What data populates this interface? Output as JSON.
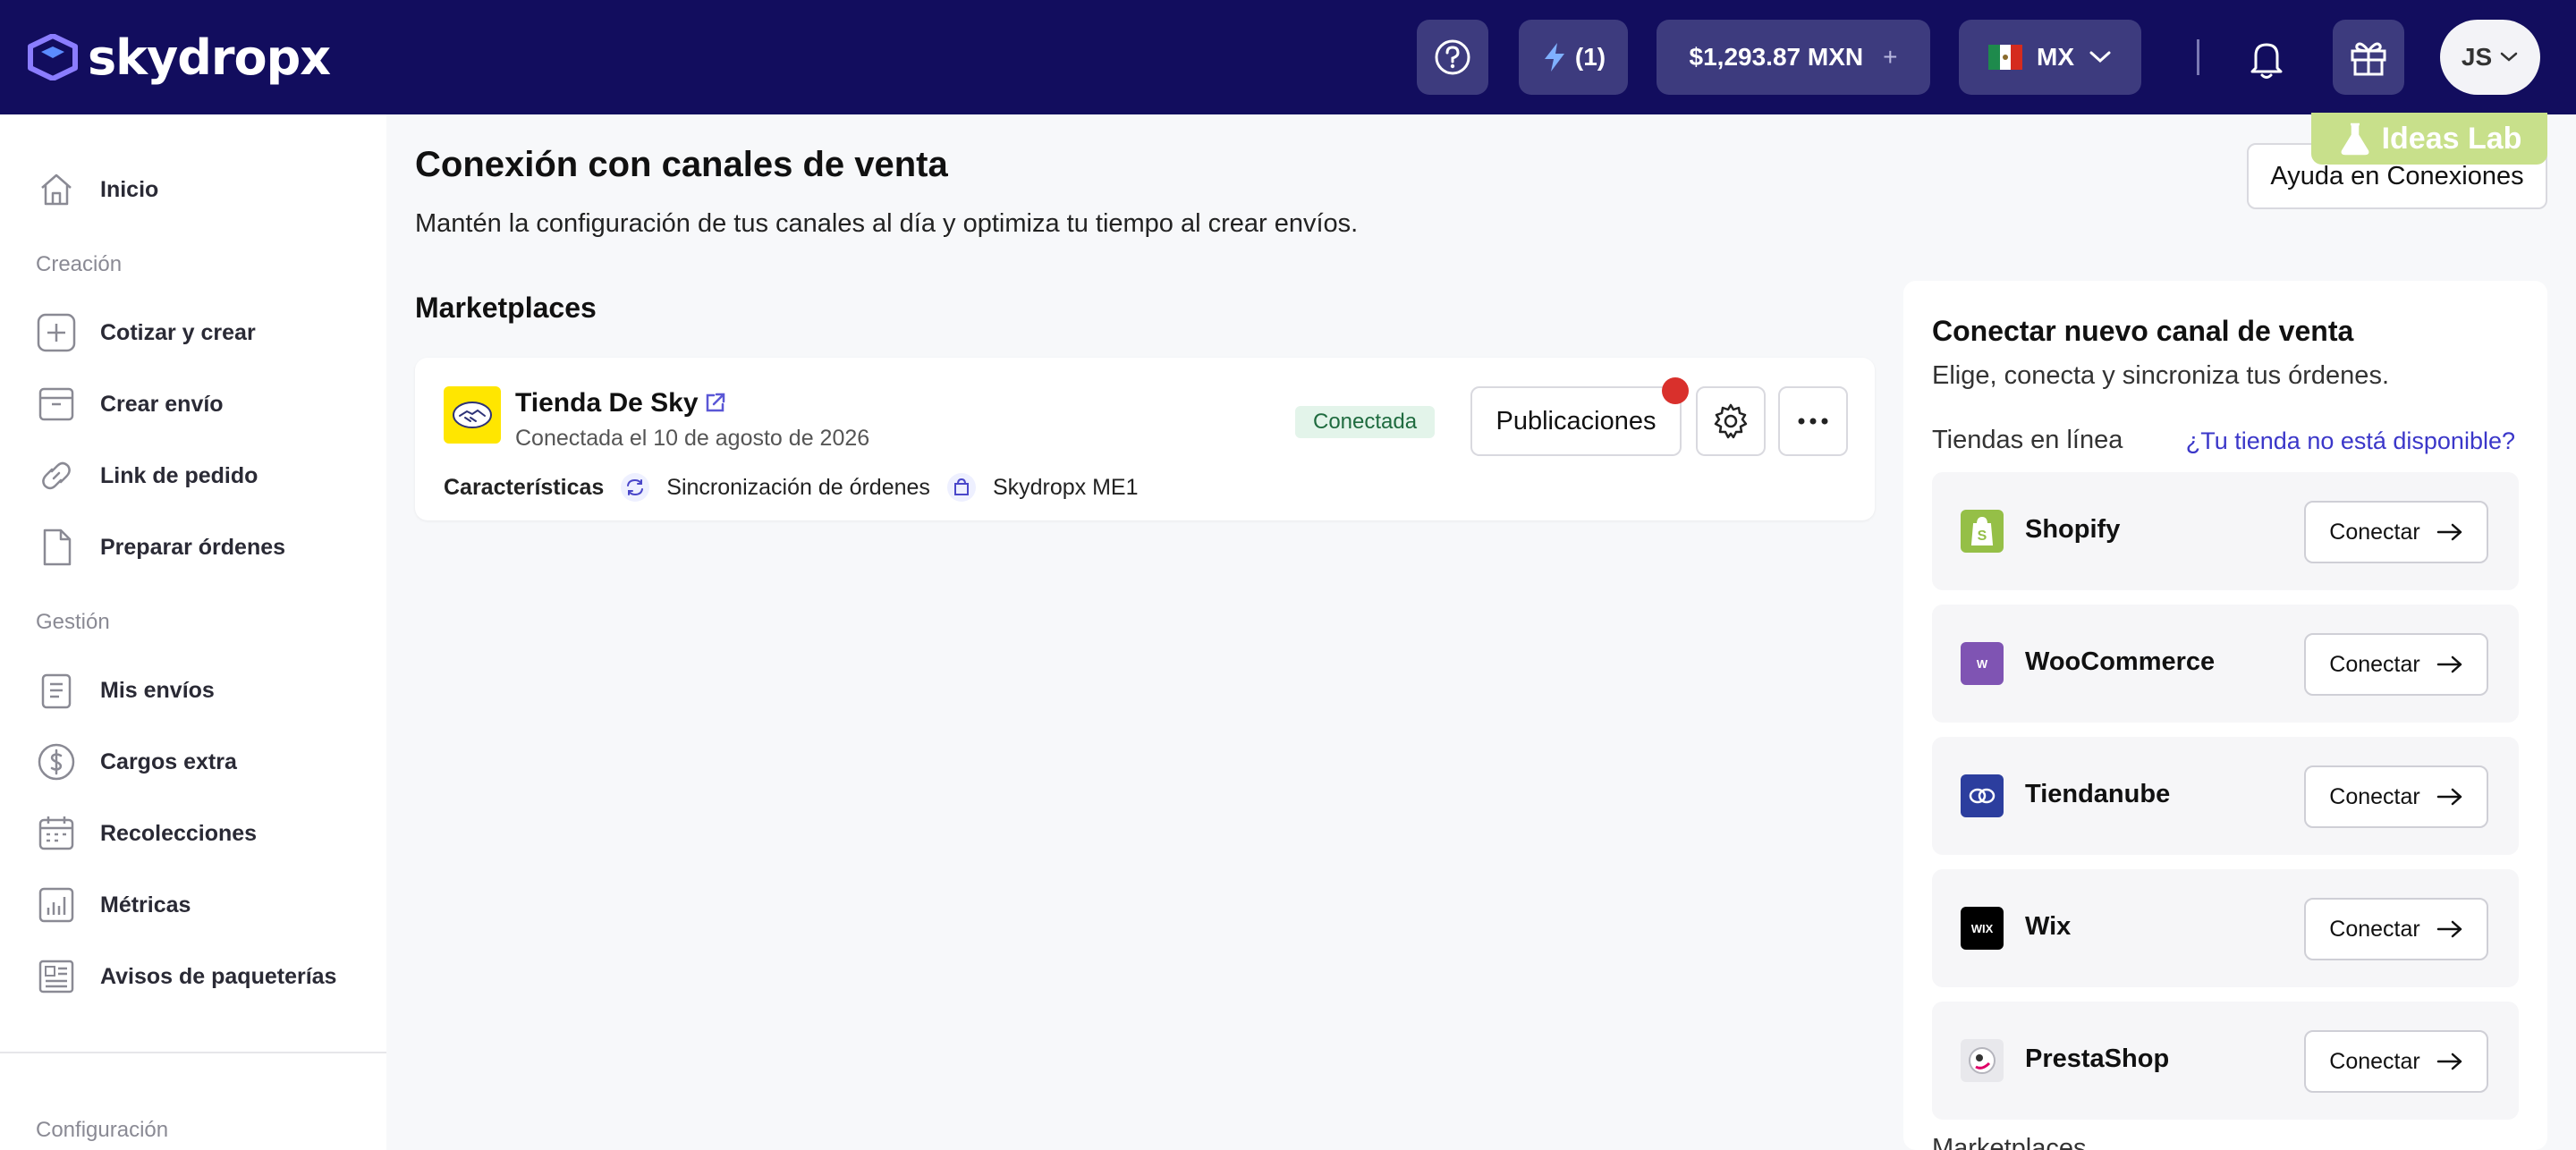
{
  "brand": {
    "name": "skydropx"
  },
  "topbar": {
    "help_icon": "question-circle-icon",
    "lightning_label": "(1)",
    "balance": "$1,293.87 MXN",
    "balance_add": "+",
    "country": "MX",
    "user_initials": "JS"
  },
  "sidebar": {
    "home": "Inicio",
    "section_creation": "Creación",
    "creation_items": [
      "Cotizar y crear",
      "Crear envío",
      "Link de pedido",
      "Preparar órdenes"
    ],
    "section_management": "Gestión",
    "management_items": [
      "Mis envíos",
      "Cargos extra",
      "Recolecciones",
      "Métricas",
      "Avisos de paqueterías"
    ],
    "section_config": "Configuración"
  },
  "main": {
    "title": "Conexión con canales de venta",
    "subtitle": "Mantén la configuración de tus canales al día y optimiza tu tiempo al crear envíos.",
    "help_button": "Ayuda en Conexiones",
    "ideas_lab": "Ideas Lab",
    "section_marketplaces": "Marketplaces",
    "store": {
      "name": "Tienda De Sky",
      "connected_date": "Conectada el 10 de agosto de 2026",
      "status": "Conectada",
      "publications_button": "Publicaciones",
      "features_label": "Características",
      "feature_sync": "Sincronización de órdenes",
      "feature_me1": "Skydropx ME1"
    }
  },
  "right_panel": {
    "title": "Conectar nuevo canal de venta",
    "subtitle": "Elige, conecta y sincroniza tus órdenes.",
    "online_stores": "Tiendas en línea",
    "not_available_link": "¿Tu tienda no está disponible?",
    "connect_label": "Conectar",
    "stores": [
      "Shopify",
      "WooCommerce",
      "Tiendanube",
      "Wix",
      "PrestaShop"
    ],
    "more_section": "Marketplaces"
  },
  "colors": {
    "topbar": "#120d5e",
    "accent_link": "#3b37c9",
    "status_green": "#e3f4ea",
    "notification_red": "#d9302c"
  }
}
